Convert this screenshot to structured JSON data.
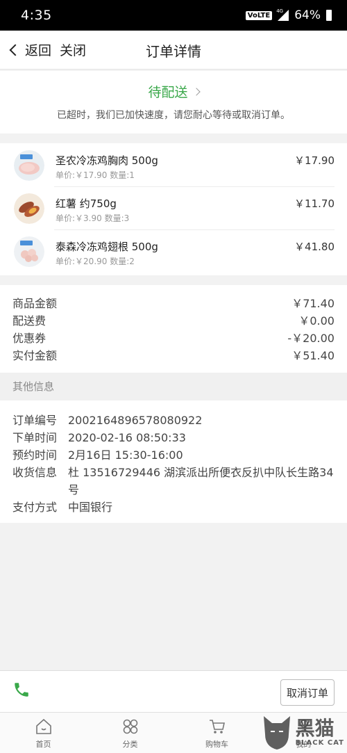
{
  "status_bar": {
    "time": "4:35",
    "volte": "VoLTE",
    "network": "4G",
    "battery": "64%"
  },
  "nav": {
    "back_label": "返回",
    "close_label": "关闭",
    "title": "订单详情"
  },
  "order_status": {
    "label": "待配送",
    "message": "已超时，我们已加快速度，请您耐心等待或取消订单。"
  },
  "items": [
    {
      "name": "圣农冷冻鸡胸肉 500g",
      "sub": "单价:￥17.90 数量:1",
      "price": "￥17.90"
    },
    {
      "name": "红薯 约750g",
      "sub": "单价:￥3.90 数量:3",
      "price": "￥11.70"
    },
    {
      "name": "泰森冷冻鸡翅根 500g",
      "sub": "单价:￥20.90 数量:2",
      "price": "￥41.80"
    }
  ],
  "totals": [
    {
      "label": "商品金额",
      "value": "￥71.40"
    },
    {
      "label": "配送费",
      "value": "￥0.00"
    },
    {
      "label": "优惠券",
      "value": "-￥20.00"
    },
    {
      "label": "实付金额",
      "value": "￥51.40"
    }
  ],
  "other_header": "其他信息",
  "info": [
    {
      "label": "订单编号",
      "value": "2002164896578080922"
    },
    {
      "label": "下单时间",
      "value": "2020-02-16 08:50:33"
    },
    {
      "label": "预约时间",
      "value": "2月16日 15:30-16:00"
    },
    {
      "label": "收货信息",
      "value": "杜 13516729446 湖滨派出所便衣反扒中队长生路34号"
    },
    {
      "label": "支付方式",
      "value": "中国银行"
    }
  ],
  "actions": {
    "cancel_label": "取消订单"
  },
  "tabs": [
    {
      "label": "首页",
      "icon": "home-icon"
    },
    {
      "label": "分类",
      "icon": "category-icon"
    },
    {
      "label": "购物车",
      "icon": "cart-icon"
    },
    {
      "label": "我的",
      "icon": "user-icon"
    }
  ],
  "watermark": {
    "text": "黑猫",
    "sub": "BLACK CAT"
  },
  "colors": {
    "accent_green": "#3aa84a",
    "phone_green": "#3aa84a"
  }
}
